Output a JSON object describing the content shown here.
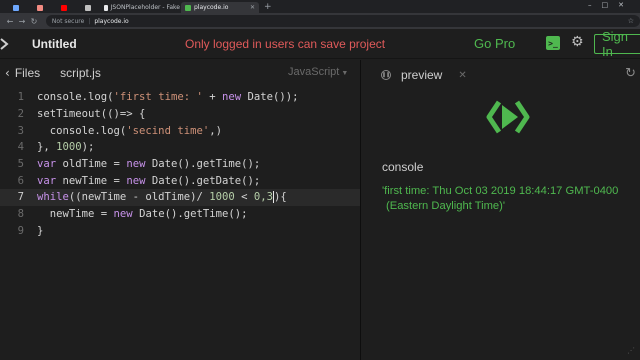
{
  "browser": {
    "tabs": [
      {
        "label": "",
        "favicon_color": "#6ea8fe"
      },
      {
        "label": "",
        "favicon_color": "#f28b82"
      },
      {
        "label": "",
        "favicon_color": "#ff0000"
      },
      {
        "label": "",
        "favicon_color": "#e8eaed"
      },
      {
        "label": "JSONPlaceholder - Fake",
        "favicon_color": "#e8eaed"
      },
      {
        "label": "playcode.io",
        "favicon_color": "#4fb84f",
        "active": true
      }
    ],
    "not_secure": "Not secure",
    "url": "playcode.io"
  },
  "header": {
    "title": "Untitled",
    "save_warning": "Only logged in users can save project",
    "go_pro": "Go Pro",
    "terminal_glyph": ">_",
    "sign_in": "Sign In"
  },
  "editor": {
    "back_glyph": "‹",
    "files_label": "Files",
    "file_tab": "script.js",
    "language": "JavaScript",
    "current_line": 7,
    "lines": [
      {
        "n": "1"
      },
      {
        "n": "2"
      },
      {
        "n": "3"
      },
      {
        "n": "4"
      },
      {
        "n": "5"
      },
      {
        "n": "6"
      },
      {
        "n": "7"
      },
      {
        "n": "8"
      },
      {
        "n": "9"
      }
    ],
    "code": {
      "l1": {
        "a": "console.log(",
        "s": "'first time: '",
        "b": " + ",
        "k": "new",
        "c": " Date());"
      },
      "l2": {
        "a": "setTimeout(()=> {"
      },
      "l3": {
        "a": "  console.log(",
        "s": "'secind time'",
        "b": ",)"
      },
      "l4": {
        "a": "}, ",
        "n": "1000",
        "b": ");"
      },
      "l5": {
        "k": "var",
        "a": " oldTime = ",
        "k2": "new",
        "b": " Date().getTime();"
      },
      "l6": {
        "k": "var",
        "a": " newTime = ",
        "k2": "new",
        "b": " Date().getDate();"
      },
      "l7": {
        "k": "while",
        "a": "((newTime - oldTime)/ ",
        "n": "1000",
        "b": " < ",
        "n2": "0,3",
        "c": "){"
      },
      "l8": {
        "a": "  newTime = ",
        "k": "new",
        "b": " Date().getTime();"
      },
      "l9": {
        "a": "}"
      }
    }
  },
  "preview": {
    "tab_label": "preview",
    "console_label": "console",
    "console_line1": "'first time: Thu Oct 03 2019 18:44:17 GMT-0400",
    "console_line2": "(Eastern Daylight Time)'"
  },
  "colors": {
    "accent": "#4fb84f",
    "warning": "#e05a5a",
    "background": "#1e1e1e"
  },
  "icons": [
    "playcode-logo-icon",
    "back-chevron-icon",
    "caret-down-icon",
    "pause-icon",
    "close-icon",
    "refresh-icon",
    "terminal-icon",
    "gear-icon",
    "star-icon"
  ]
}
